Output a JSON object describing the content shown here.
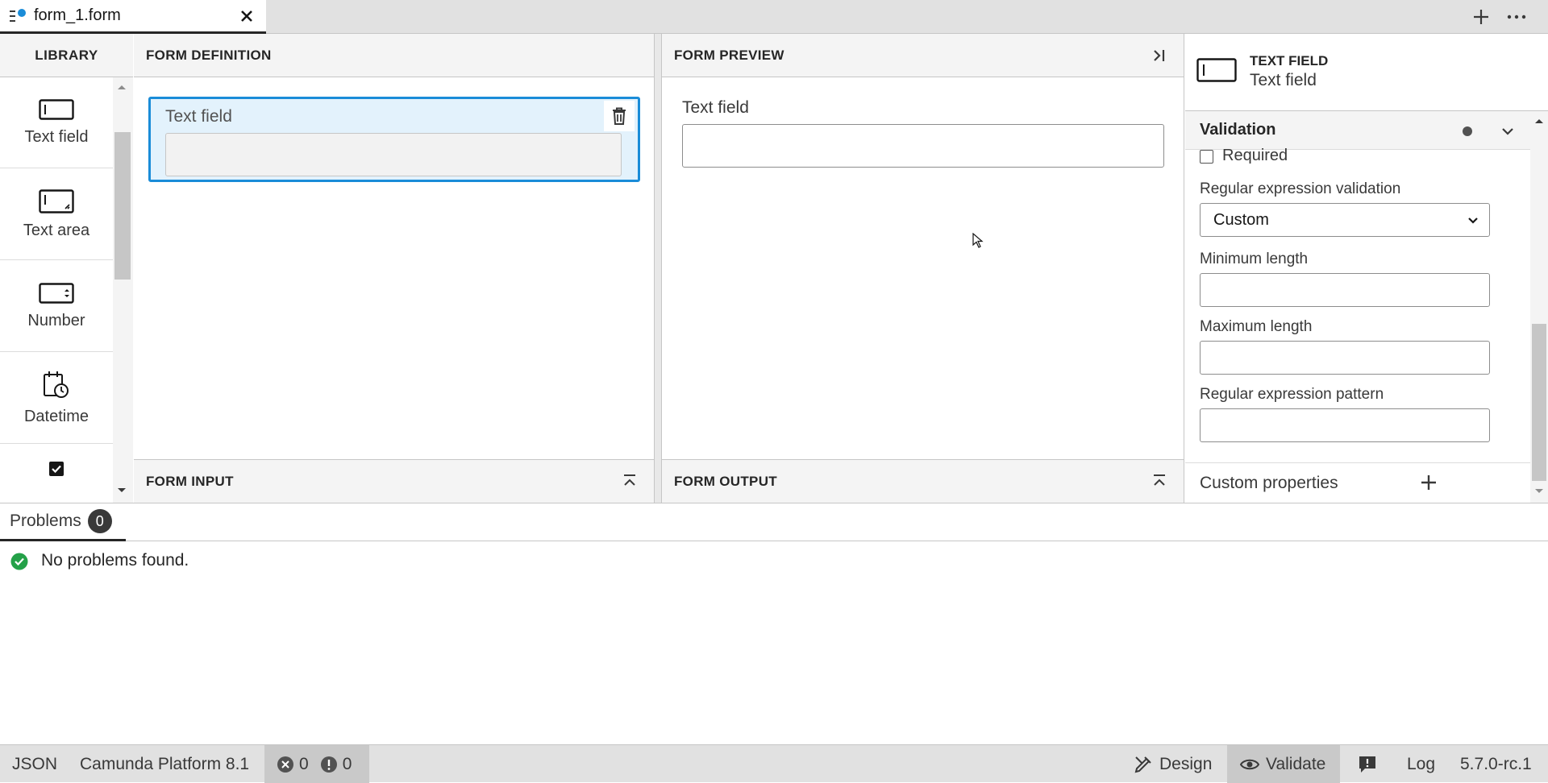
{
  "tab": {
    "title": "form_1.form"
  },
  "library": {
    "title": "LIBRARY",
    "items": [
      {
        "label": "Text field"
      },
      {
        "label": "Text area"
      },
      {
        "label": "Number"
      },
      {
        "label": "Datetime"
      },
      {
        "label": ""
      }
    ]
  },
  "definition": {
    "title": "FORM DEFINITION",
    "field_label": "Text field",
    "footer": "FORM INPUT"
  },
  "preview": {
    "title": "FORM PREVIEW",
    "field_label": "Text field",
    "footer": "FORM OUTPUT"
  },
  "properties": {
    "type": "TEXT FIELD",
    "name": "Text field",
    "group": "Validation",
    "required_label": "Required",
    "regex_validation_label": "Regular expression validation",
    "regex_validation_value": "Custom",
    "min_length_label": "Minimum length",
    "max_length_label": "Maximum length",
    "regex_pattern_label": "Regular expression pattern",
    "custom_properties_label": "Custom properties"
  },
  "problems": {
    "tab_label": "Problems",
    "count": "0",
    "message": "No problems found."
  },
  "statusbar": {
    "format": "JSON",
    "platform": "Camunda Platform 8.1",
    "errors": "0",
    "warnings": "0",
    "design": "Design",
    "validate": "Validate",
    "log": "Log",
    "version": "5.7.0-rc.1"
  },
  "colors": {
    "accent": "#1a8cd8",
    "success": "#24a148"
  }
}
